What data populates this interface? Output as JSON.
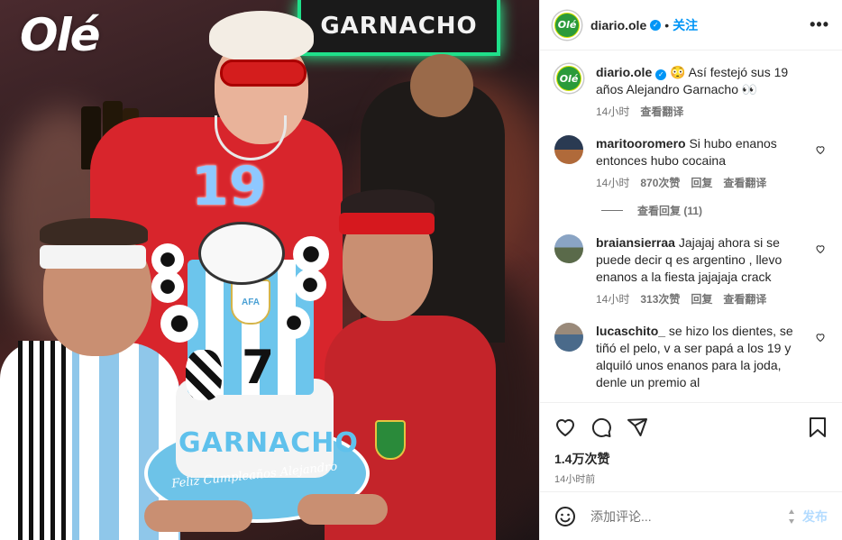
{
  "photo": {
    "sign_text": "GARNACHO",
    "logo_text": "Olé",
    "cake_text": "GARNACHO",
    "cake_number": "7",
    "shirt_number": "19",
    "cake_inscription": "Feliz Cumpleaños Alejandro",
    "badge_text": "AFA"
  },
  "header": {
    "avatar_text": "Olé",
    "username": "diario.ole",
    "follow_label": "关注",
    "more_label": "•••"
  },
  "caption": {
    "username": "diario.ole",
    "text": "😳 Así festejó sus 19 años Alejandro Garnacho 👀",
    "time": "14小时",
    "translate": "查看翻译"
  },
  "comments": [
    {
      "username": "maritooromero",
      "text": "Si hubo enanos entonces hubo cocaina",
      "time": "14小时",
      "likes": "870次赞",
      "reply": "回复",
      "translate": "查看翻译",
      "view_replies": "查看回复 (11)"
    },
    {
      "username": "braiansierraa",
      "text": "Jajajaj ahora si se puede decir q es argentino , llevo enanos a la fiesta jajajaja crack",
      "time": "14小时",
      "likes": "313次赞",
      "reply": "回复",
      "translate": "查看翻译"
    },
    {
      "username": "lucaschito_",
      "text": "se hizo los dientes, se tiñó el pelo, v a ser papá a los 19 y alquiló unos enanos para la joda, denle un premio al",
      "time": "",
      "likes": "",
      "reply": "",
      "translate": ""
    }
  ],
  "footer": {
    "likes": "1.4万次赞",
    "time": "14小时前",
    "comment_placeholder": "添加评论...",
    "post_label": "发布"
  },
  "colors": {
    "accent": "#0095f6",
    "post_disabled": "#b3dbff",
    "meta_gray": "#737373",
    "ole_green": "#2a9a3a",
    "ole_yellow": "#d8e400",
    "neon_green": "#1fe08a"
  },
  "icons": [
    "heart-icon",
    "comment-icon",
    "share-icon",
    "bookmark-icon",
    "emoji-icon",
    "more-icon",
    "verified-icon"
  ]
}
